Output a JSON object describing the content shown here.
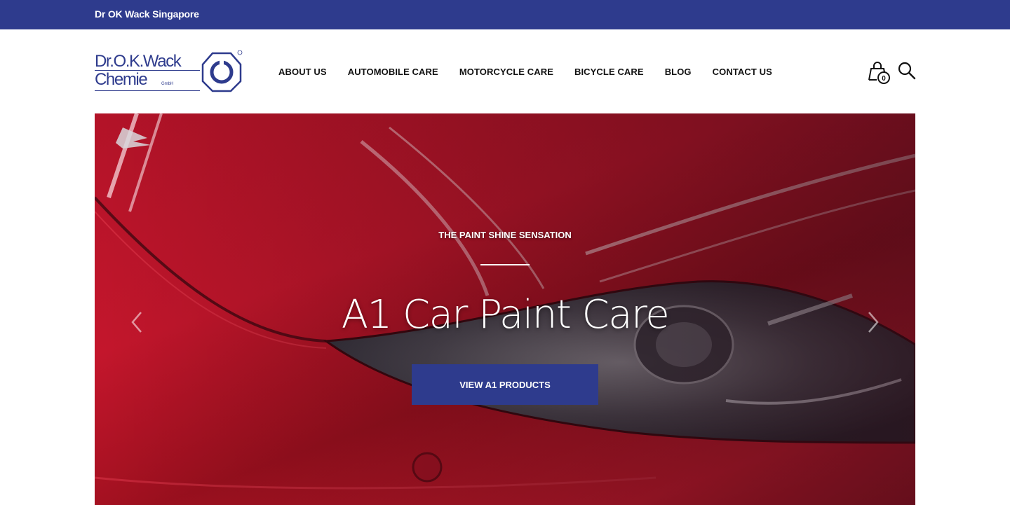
{
  "topbar": {
    "site_name": "Dr OK Wack Singapore"
  },
  "logo": {
    "line1": "Dr.O.K.Wack",
    "line2": "Chemie",
    "suffix": "GmbH"
  },
  "nav": {
    "items": [
      {
        "label": "ABOUT US"
      },
      {
        "label": "AUTOMOBILE CARE"
      },
      {
        "label": "MOTORCYCLE CARE"
      },
      {
        "label": "BICYCLE CARE"
      },
      {
        "label": "BLOG"
      },
      {
        "label": "CONTACT US"
      }
    ]
  },
  "cart": {
    "count": "0",
    "icon": "shopping-bag-icon"
  },
  "search": {
    "icon": "search-icon"
  },
  "hero": {
    "eyebrow": "THE PAINT SHINE SENSATION",
    "headline": "A1 Car Paint Care",
    "cta_label": "VIEW A1 PRODUCTS",
    "prev_icon": "chevron-left-icon",
    "next_icon": "chevron-right-icon"
  },
  "colors": {
    "brand": "#2e3b8d",
    "hero_red": "#c4162c",
    "text": "#111111",
    "white": "#ffffff"
  }
}
